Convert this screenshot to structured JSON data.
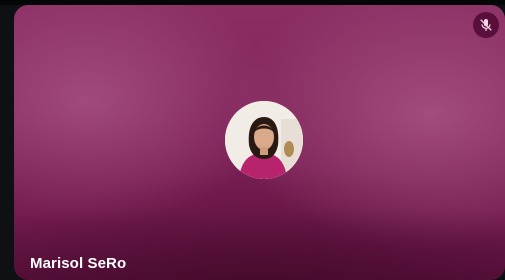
{
  "participant": {
    "name": "Marisol SeRo",
    "microphone": "muted"
  },
  "icons": {
    "mic_status": "microphone-off-icon"
  },
  "colors": {
    "tile_background": "#7e2259",
    "mute_badge": "#5a0f3b",
    "name_text": "#ffffff"
  }
}
